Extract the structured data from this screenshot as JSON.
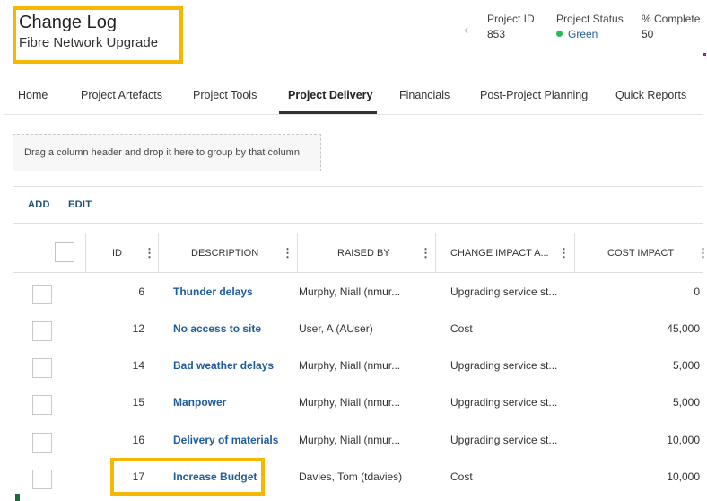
{
  "header": {
    "title": "Change Log",
    "subtitle": "Fibre Network Upgrade",
    "project_id_label": "Project ID",
    "project_id": "853",
    "status_label": "Project Status",
    "status": "Green",
    "complete_label": "% Complete",
    "complete": "50",
    "status_color": "#2eb85c",
    "highlight_color": "#f5b800"
  },
  "tabs": [
    {
      "label": "Home",
      "active": false
    },
    {
      "label": "Project Artefacts",
      "active": false
    },
    {
      "label": "Project Tools",
      "active": false
    },
    {
      "label": "Project Delivery",
      "active": true
    },
    {
      "label": "Financials",
      "active": false
    },
    {
      "label": "Post-Project Planning",
      "active": false
    },
    {
      "label": "Quick Reports",
      "active": false
    }
  ],
  "grouping_hint": "Drag a column header and drop it here to group by that column",
  "toolbar": {
    "add_label": "ADD",
    "edit_label": "EDIT"
  },
  "grid": {
    "columns": [
      "ID",
      "DESCRIPTION",
      "RAISED BY",
      "CHANGE IMPACT A...",
      "COST IMPACT"
    ],
    "rows": [
      {
        "id": "6",
        "description": "Thunder delays",
        "raised_by": "Murphy, Niall (nmur...",
        "impact_area": "Upgrading service st...",
        "cost_impact": "0"
      },
      {
        "id": "12",
        "description": "No access to site",
        "raised_by": "User, A (AUser)",
        "impact_area": "Cost",
        "cost_impact": "45,000"
      },
      {
        "id": "14",
        "description": "Bad weather delays",
        "raised_by": "Murphy, Niall (nmur...",
        "impact_area": "Upgrading service st...",
        "cost_impact": "5,000"
      },
      {
        "id": "15",
        "description": "Manpower",
        "raised_by": "Murphy, Niall (nmur...",
        "impact_area": "Upgrading service st...",
        "cost_impact": "5,000"
      },
      {
        "id": "16",
        "description": "Delivery of materials",
        "raised_by": "Murphy, Niall (nmur...",
        "impact_area": "Upgrading service st...",
        "cost_impact": "10,000"
      },
      {
        "id": "17",
        "description": "Increase Budget",
        "raised_by": "Davies, Tom (tdavies)",
        "impact_area": "Cost",
        "cost_impact": "10,000"
      }
    ]
  }
}
